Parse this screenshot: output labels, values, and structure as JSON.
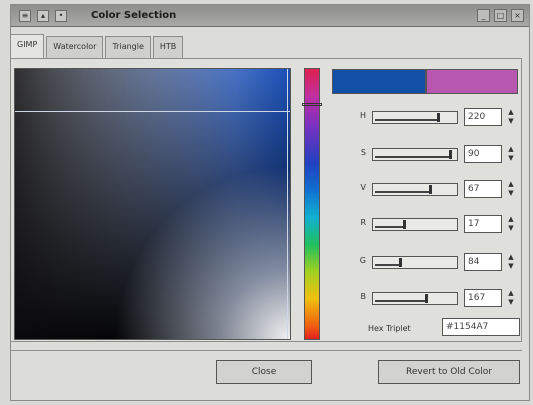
{
  "window": {
    "title": "Color Selection"
  },
  "tabs": [
    {
      "label": "GIMP",
      "active": true
    },
    {
      "label": "Watercolor",
      "active": false
    },
    {
      "label": "Triangle",
      "active": false
    },
    {
      "label": "HTB",
      "active": false
    }
  ],
  "colors": {
    "new": "#124fa6",
    "old": "#b857b0"
  },
  "channels": [
    {
      "label": "H",
      "value": "220"
    },
    {
      "label": "S",
      "value": "90"
    },
    {
      "label": "V",
      "value": "67"
    },
    {
      "label": "R",
      "value": "17"
    },
    {
      "label": "G",
      "value": "84"
    },
    {
      "label": "B",
      "value": "167"
    }
  ],
  "hex": {
    "label": "Hex Triplet",
    "value": "#1154A7"
  },
  "buttons": {
    "close": "Close",
    "revert": "Revert to Old Color"
  }
}
